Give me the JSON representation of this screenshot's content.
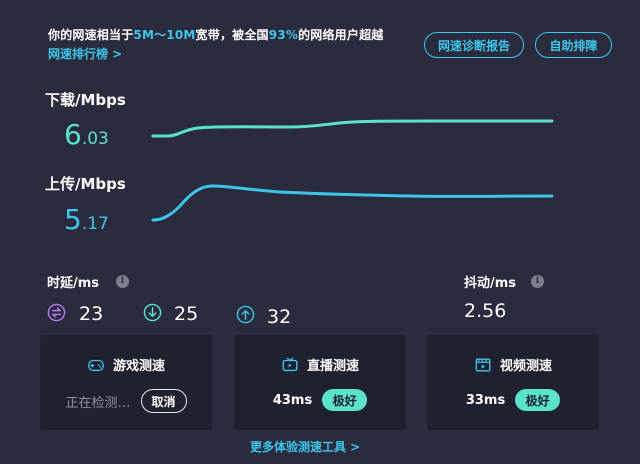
{
  "summary": {
    "prefix": "你的网速相当于",
    "bandwidth": "5M～10M",
    "middle": "宽带，被全国",
    "percent": "93%",
    "suffix": "的网络用户超越"
  },
  "rank_link": "网速排行榜 >",
  "buttons": {
    "diagnose": "网速诊断报告",
    "help": "自助排障"
  },
  "download": {
    "label": "下载/Mbps",
    "int": "6",
    "dec": ".03"
  },
  "upload": {
    "label": "上传/Mbps",
    "int": "5",
    "dec": ".17"
  },
  "latency": {
    "label": "时延/ms",
    "values": [
      "23",
      "25",
      "32"
    ]
  },
  "jitter": {
    "label": "抖动/ms",
    "value": "2.56"
  },
  "info_glyph": "i",
  "cards": {
    "game": {
      "title": "游戏测速",
      "status": "正在检测…",
      "cancel": "取消"
    },
    "live": {
      "title": "直播测速",
      "ms": "43ms",
      "badge": "极好"
    },
    "video": {
      "title": "视频测速",
      "ms": "33ms",
      "badge": "极好"
    }
  },
  "more_link": "更多体验测速工具 >",
  "colors": {
    "background": "#2a2b3d",
    "card": "#1f2030",
    "accent_blue": "#3ec5ea",
    "accent_green": "#5ae3c6",
    "latency_purple": "#b77cf0"
  },
  "icons": [
    "info-icon",
    "exchange-icon",
    "download-arrow-icon",
    "upload-arrow-icon",
    "gamepad-icon",
    "tv-icon",
    "video-film-icon"
  ]
}
